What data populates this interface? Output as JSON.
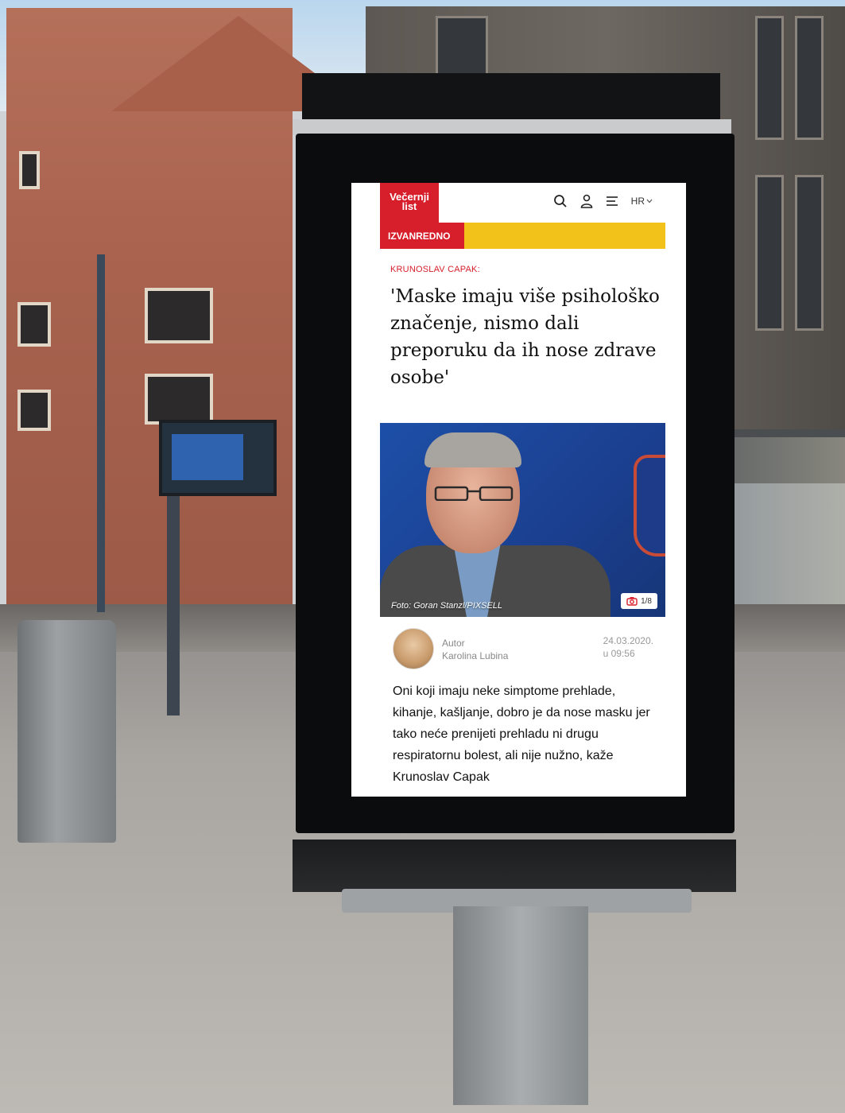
{
  "site": {
    "logo_line1": "Večernji",
    "logo_line2": "list",
    "language": "HR",
    "breaking_label": "IZVANREDNO"
  },
  "article": {
    "kicker": "KRUNOSLAV CAPAK:",
    "headline": "'Maske imaju više psihološko značenje, nismo dali preporuku da ih nose zdrave osobe'",
    "photo_credit": "Foto: Goran Stanzl/PIXSELL",
    "gallery_count": "1/8",
    "author_label": "Autor",
    "author_name": "Karolina Lubina",
    "date": "24.03.2020.",
    "time": "u 09:56",
    "body": "Oni koji imaju neke simptome prehlade, kihanje, kašljanje, dobro je da nose masku jer tako neće prenijeti prehladu ni drugu respiratornu bolest, ali nije nužno, kaže Krunoslav Capak"
  },
  "icons": [
    "search-icon",
    "user-icon",
    "menu-icon",
    "chevron-down-icon",
    "camera-icon"
  ],
  "colors": {
    "brand_red": "#d71e2b",
    "breaking_yellow": "#f2c21a"
  }
}
